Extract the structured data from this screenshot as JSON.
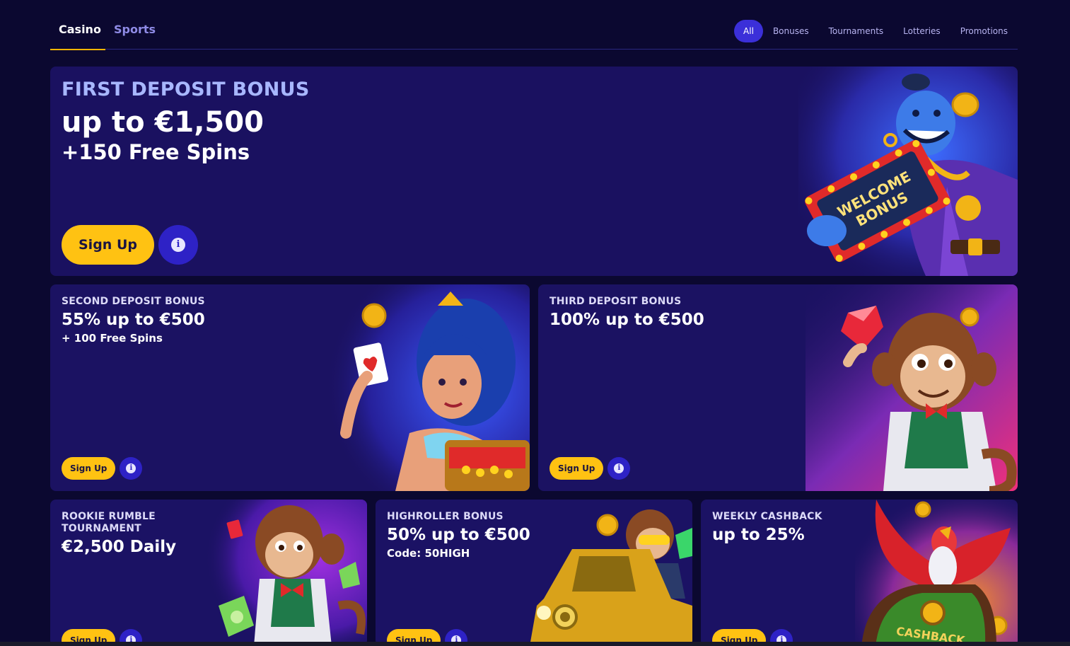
{
  "nav": {
    "tabs": [
      {
        "label": "Casino",
        "active": true
      },
      {
        "label": "Sports",
        "active": false
      }
    ],
    "filters": [
      {
        "label": "All",
        "active": true
      },
      {
        "label": "Bonuses"
      },
      {
        "label": "Tournaments"
      },
      {
        "label": "Lotteries"
      },
      {
        "label": "Promotions"
      }
    ]
  },
  "hero": {
    "kicker": "FIRST DEPOSIT BONUS",
    "headline": "up to €1,500",
    "subline": "+150 Free Spins",
    "sign_up": "Sign Up",
    "sign_text": "WELCOME BONUS"
  },
  "cards": {
    "second": {
      "kicker": "SECOND DEPOSIT BONUS",
      "headline": "55% up to €500",
      "subline": "+ 100 Free Spins",
      "sign_up": "Sign Up"
    },
    "third": {
      "kicker": "THIRD DEPOSIT BONUS",
      "headline": "100% up to €500",
      "sign_up": "Sign Up"
    },
    "rookie": {
      "kicker": "ROOKIE RUMBLE TOURNAMENT",
      "headline": "€2,500 Daily",
      "sign_up": "Sign Up"
    },
    "highroller": {
      "kicker": "HIGHROLLER BONUS",
      "headline": "50% up to €500",
      "subline": "Code: 50HIGH",
      "sign_up": "Sign Up"
    },
    "cashback": {
      "kicker": "WEEKLY CASHBACK",
      "headline": "up to 25%",
      "sign_up": "Sign Up",
      "art_text": "CASHBACK"
    }
  },
  "colors": {
    "background": "#0b0830",
    "card": "#1b1262",
    "accent_yellow": "#ffc212",
    "accent_blue": "#2e22c6",
    "hero_kicker": "#a8b7ff"
  },
  "icons": {
    "info": "info-icon"
  }
}
